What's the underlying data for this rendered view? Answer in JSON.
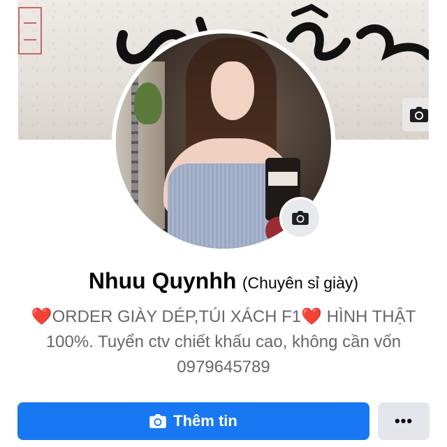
{
  "profile": {
    "name": "Nhuu Quynhh",
    "alternate_name": "(Chuyên sỉ giày)"
  },
  "bio": {
    "heart_left": "❤️",
    "line1_text": "ORDER GIÀY DÉP,TÚI XÁCH F1",
    "heart_right": "❤️",
    "line1_suffix": " HÌNH THẬT",
    "line2": "100%. Tuyển ctv chiết khấu cao, không cần vốn",
    "line3": "0979645789"
  },
  "actions": {
    "primary_label": "Thêm tin",
    "more_label": "•••"
  },
  "icons": {
    "cover_camera": "camera-icon",
    "avatar_camera": "camera-icon",
    "primary_button": "camera-icon"
  },
  "colors": {
    "primary": "#1877f2",
    "secondary_button": "#e4e6eb",
    "bio_text": "#65676b",
    "heart": "#e0202e"
  }
}
